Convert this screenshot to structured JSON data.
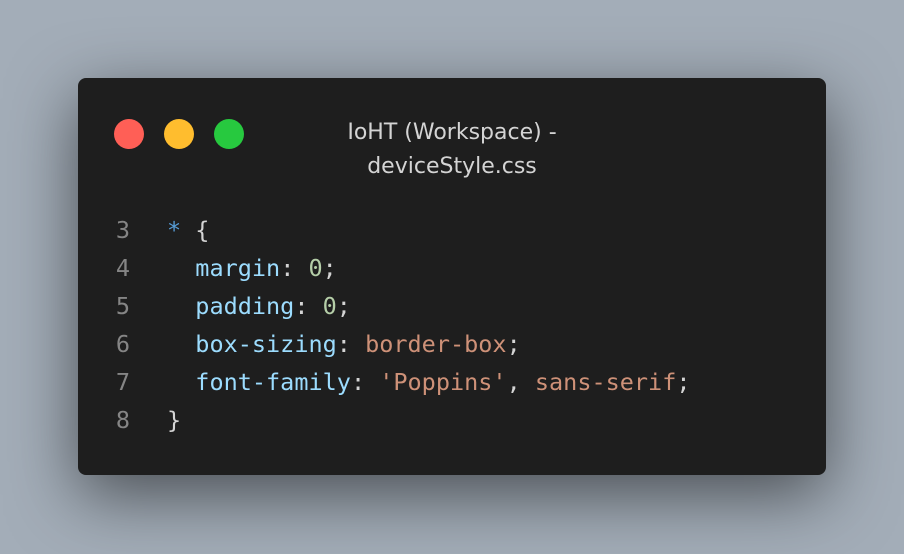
{
  "window": {
    "title_line1": "IoHT (Workspace) -",
    "title_line2": "deviceStyle.css",
    "buttons": {
      "close_color": "#ff5f56",
      "minimize_color": "#ffbd2e",
      "maximize_color": "#27c93f"
    }
  },
  "code": {
    "lines": [
      {
        "number": "3",
        "indent": "",
        "tokens": [
          {
            "type": "sel",
            "text": "*"
          },
          {
            "type": "punc",
            "text": " {"
          }
        ]
      },
      {
        "number": "4",
        "indent": "  ",
        "tokens": [
          {
            "type": "prop",
            "text": "margin"
          },
          {
            "type": "punc",
            "text": ": "
          },
          {
            "type": "num",
            "text": "0"
          },
          {
            "type": "punc",
            "text": ";"
          }
        ]
      },
      {
        "number": "5",
        "indent": "  ",
        "tokens": [
          {
            "type": "prop",
            "text": "padding"
          },
          {
            "type": "punc",
            "text": ": "
          },
          {
            "type": "num",
            "text": "0"
          },
          {
            "type": "punc",
            "text": ";"
          }
        ]
      },
      {
        "number": "6",
        "indent": "  ",
        "tokens": [
          {
            "type": "prop",
            "text": "box-sizing"
          },
          {
            "type": "punc",
            "text": ": "
          },
          {
            "type": "val",
            "text": "border-box"
          },
          {
            "type": "punc",
            "text": ";"
          }
        ]
      },
      {
        "number": "7",
        "indent": "  ",
        "tokens": [
          {
            "type": "prop",
            "text": "font-family"
          },
          {
            "type": "punc",
            "text": ": "
          },
          {
            "type": "str",
            "text": "'Poppins'"
          },
          {
            "type": "punc",
            "text": ", "
          },
          {
            "type": "val",
            "text": "sans-serif"
          },
          {
            "type": "punc",
            "text": ";"
          }
        ]
      },
      {
        "number": "8",
        "indent": "",
        "tokens": [
          {
            "type": "punc",
            "text": "}"
          }
        ]
      }
    ]
  }
}
